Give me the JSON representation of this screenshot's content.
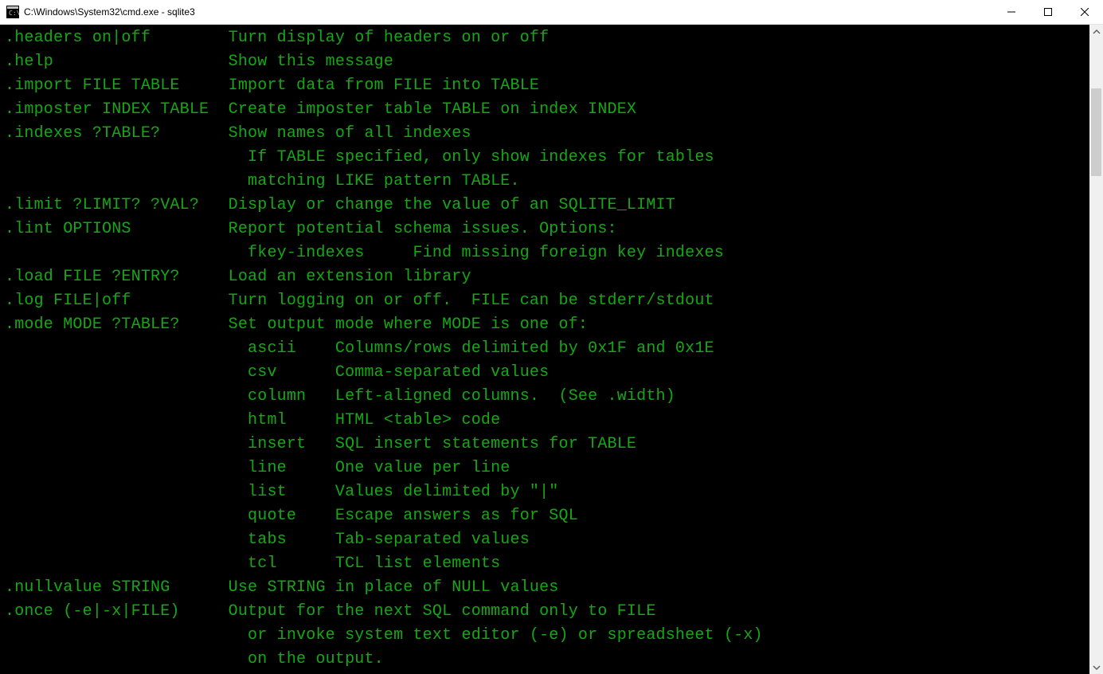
{
  "window": {
    "title": "C:\\Windows\\System32\\cmd.exe - sqlite3"
  },
  "terminal": {
    "lines": [
      ".headers on|off        Turn display of headers on or off",
      ".help                  Show this message",
      ".import FILE TABLE     Import data from FILE into TABLE",
      ".imposter INDEX TABLE  Create imposter table TABLE on index INDEX",
      ".indexes ?TABLE?       Show names of all indexes",
      "                         If TABLE specified, only show indexes for tables",
      "                         matching LIKE pattern TABLE.",
      ".limit ?LIMIT? ?VAL?   Display or change the value of an SQLITE_LIMIT",
      ".lint OPTIONS          Report potential schema issues. Options:",
      "                         fkey-indexes     Find missing foreign key indexes",
      ".load FILE ?ENTRY?     Load an extension library",
      ".log FILE|off          Turn logging on or off.  FILE can be stderr/stdout",
      ".mode MODE ?TABLE?     Set output mode where MODE is one of:",
      "                         ascii    Columns/rows delimited by 0x1F and 0x1E",
      "                         csv      Comma-separated values",
      "                         column   Left-aligned columns.  (See .width)",
      "                         html     HTML <table> code",
      "                         insert   SQL insert statements for TABLE",
      "                         line     One value per line",
      "                         list     Values delimited by \"|\"",
      "                         quote    Escape answers as for SQL",
      "                         tabs     Tab-separated values",
      "                         tcl      TCL list elements",
      ".nullvalue STRING      Use STRING in place of NULL values",
      ".once (-e|-x|FILE)     Output for the next SQL command only to FILE",
      "                         or invoke system text editor (-e) or spreadsheet (-x)",
      "                         on the output."
    ]
  }
}
